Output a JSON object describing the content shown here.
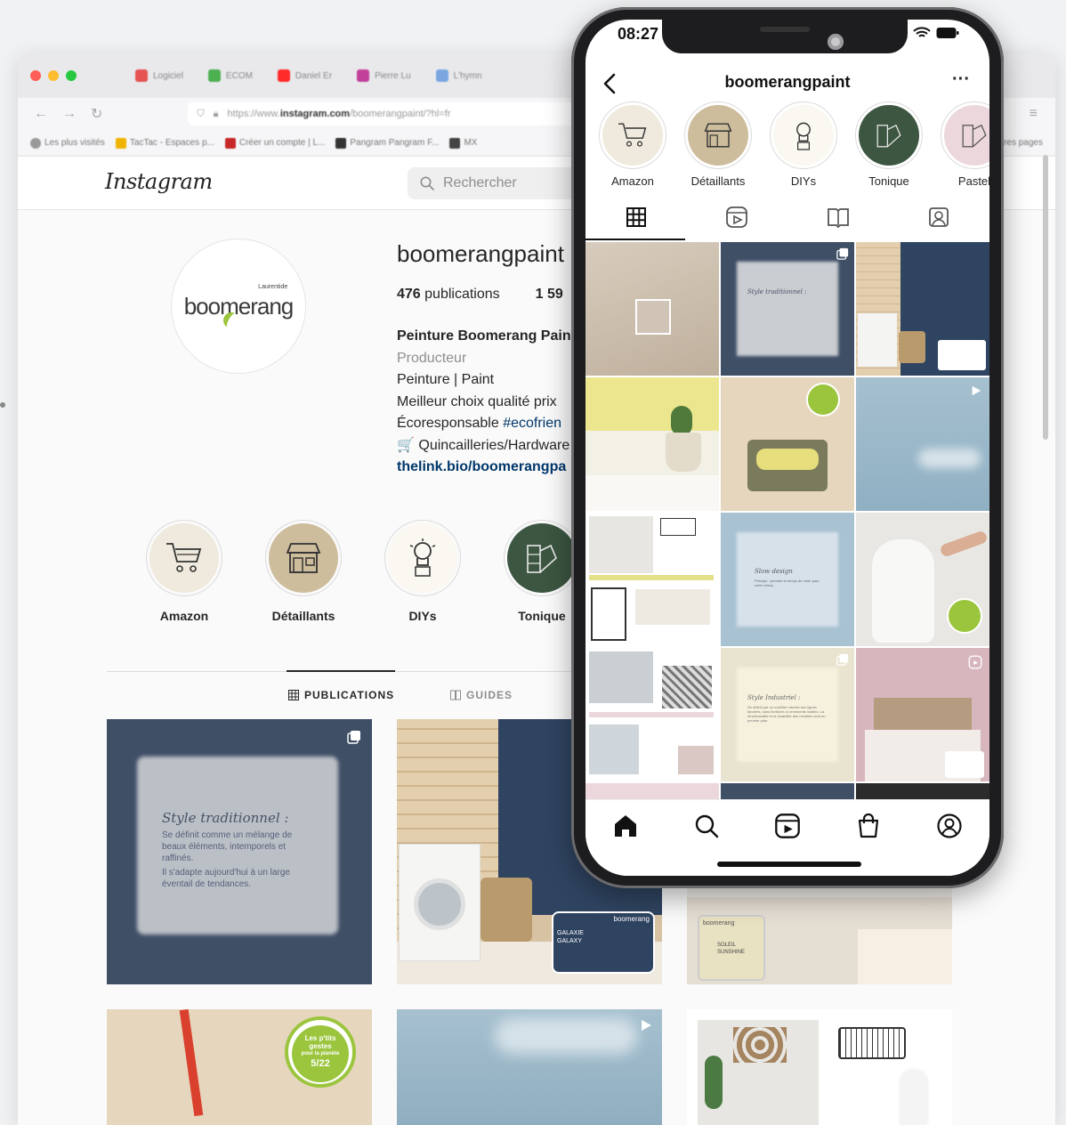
{
  "browser": {
    "tabs": [
      "Logiciel",
      "ECOM",
      "Daniel Er",
      "Pierre Lu",
      "L'hymn"
    ],
    "url_prefix": "https://www.",
    "url_domain": "instagram.com",
    "url_path": "/boomerangpaint/?hl=fr",
    "bookmarks": [
      "Les plus visités",
      "TacTac - Espaces p...",
      "Créer un compte | L...",
      "Pangram Pangram F...",
      "MX"
    ],
    "bookmarks_right": "autres pages"
  },
  "instagram": {
    "logo": "Instagram",
    "search_placeholder": "Rechercher"
  },
  "profile": {
    "username": "boomerangpaint",
    "stats": {
      "publications_count": "476",
      "publications_label": "publications",
      "followers_partial": "1 59"
    },
    "bio": {
      "name": "Peinture Boomerang Pain",
      "category": "Producteur",
      "line1": "Peinture | Paint",
      "line2": "Meilleur choix qualité prix",
      "line3_prefix": "Écoresponsable ",
      "line3_tag": "#ecofrien",
      "line4": "🛒 Quincailleries/Hardware",
      "link": "thelink.bio/boomerangpa"
    },
    "logo_small": "Laurentide",
    "logo_word": "boomerang"
  },
  "highlights": [
    {
      "label": "Amazon",
      "color": "#efeadd"
    },
    {
      "label": "Détaillants",
      "color": "#cdbd9c"
    },
    {
      "label": "DIYs",
      "color": "#faf8f1"
    },
    {
      "label": "Tonique",
      "color": "#3c5641"
    },
    {
      "label": "Pastel",
      "color": "#ecd7dc"
    }
  ],
  "profile_tabs": {
    "publications": "PUBLICATIONS",
    "guides": "GUIDES"
  },
  "posts": {
    "traditionnel_title": "Style traditionnel :",
    "traditionnel_body1": "Se définit comme un mélange de beaux éléments, intemporels et raffinés.",
    "traditionnel_body2": "Il s'adapte aujourd'hui à un large éventail de tendances.",
    "can_galaxy_line1": "GALAXIE",
    "can_galaxy_line2": "GALAXY",
    "can_soleil_line1": "SOLEIL",
    "can_soleil_line2": "SUNSHINE",
    "can_brand": "boomerang",
    "badge_line1": "Les p'tits",
    "badge_line2": "gestes",
    "badge_line3": "pour la planète",
    "badge_num": "5/22",
    "slow_title": "Slow design",
    "slow_body": "Principe : prendre le temps de créer pour créer mieux.",
    "industriel_title": "Style Industriel :",
    "industriel_body": "Se définit par un mobilier robuste aux lignes épurées, sans fioritures ni ornements inutiles. La fonctionnalité et la durabilité des meubles sont au premier plan."
  },
  "phone": {
    "time": "08:27",
    "username": "boomerangpaint",
    "more": "···"
  },
  "colors": {
    "navy": "#3f4f66",
    "accent_green": "#9bc53d",
    "tonique_green": "#3c5641",
    "link_blue": "#00376b"
  }
}
